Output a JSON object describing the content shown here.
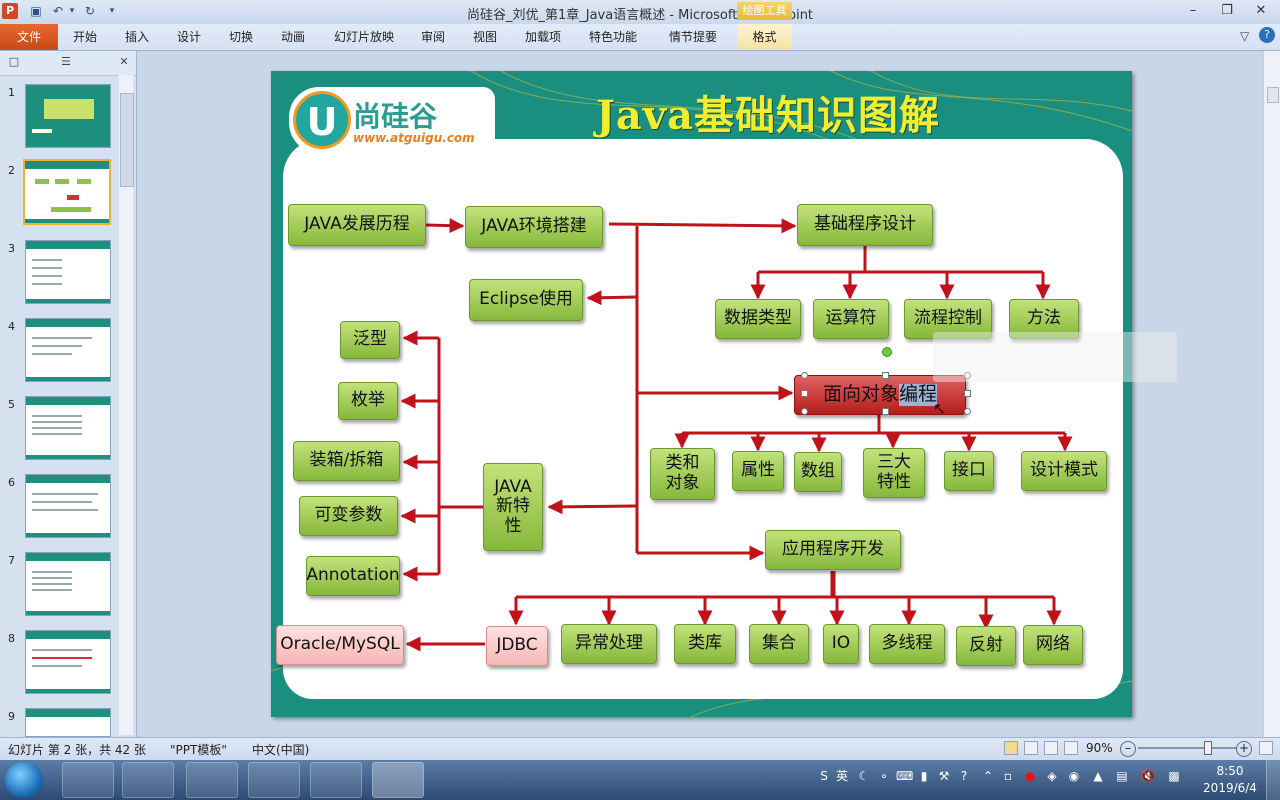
{
  "window": {
    "title": "尚硅谷_刘优_第1章_Java语言概述 - Microsoft PowerPoint",
    "contextual_group": "绘图工具",
    "app_icon": "powerpoint-icon"
  },
  "ribbon": {
    "file_tab": "文件",
    "tabs": [
      "开始",
      "插入",
      "设计",
      "切换",
      "动画",
      "幻灯片放映",
      "审阅",
      "视图",
      "加载项",
      "特色功能",
      "情节提要"
    ],
    "active_contextual_tab": "格式"
  },
  "thumbnails": {
    "numbers": [
      "1",
      "2",
      "3",
      "4",
      "5",
      "6",
      "7",
      "8",
      "9"
    ],
    "selected": "2"
  },
  "slide": {
    "title": "Java基础知识图解",
    "logo_text": "尚硅谷",
    "logo_letter": "U",
    "logo_url": "www.atguigu.com"
  },
  "mindmap": {
    "nodes": {
      "java_history": "JAVA发展历程",
      "java_env": "JAVA环境搭建",
      "basic_programming": "基础程序设计",
      "eclipse": "Eclipse使用",
      "data_types": "数据类型",
      "operators": "运算符",
      "flow_control": "流程控制",
      "methods": "方法",
      "oop_prefix": "面向对象",
      "oop_selected": "编程",
      "generics": "泛型",
      "enum": "枚举",
      "boxing": "装箱/拆箱",
      "varargs": "可变参数",
      "annotation": "Annotation",
      "java_new_features": "JAVA新特性",
      "class_object": "类和对象",
      "property": "属性",
      "array": "数组",
      "three_features": "三大特性",
      "interface": "接口",
      "design_patterns": "设计模式",
      "app_dev": "应用程序开发",
      "oracle_mysql": "Oracle/MySQL",
      "jdbc": "JDBC",
      "exception": "异常处理",
      "class_library": "类库",
      "collection": "集合",
      "io": "IO",
      "multithreading": "多线程",
      "reflection": "反射",
      "network": "网络"
    }
  },
  "statusbar": {
    "slide_info": "幻灯片 第 2 张，共 42 张",
    "theme": "\"PPT模板\"",
    "language": "中文(中国)",
    "zoom": "90%",
    "zoom_level_pct": 70
  },
  "taskbar": {
    "time": "8:50",
    "date": "2019/6/4",
    "ime": "英"
  },
  "colors": {
    "slide_teal": "#1a8f80",
    "title_yellow": "#f2ee2e",
    "node_green": "#86b83c",
    "arrow_red": "#c0121a",
    "selected_node_red": "#b61c1c",
    "file_tab_orange": "#c74a16"
  }
}
